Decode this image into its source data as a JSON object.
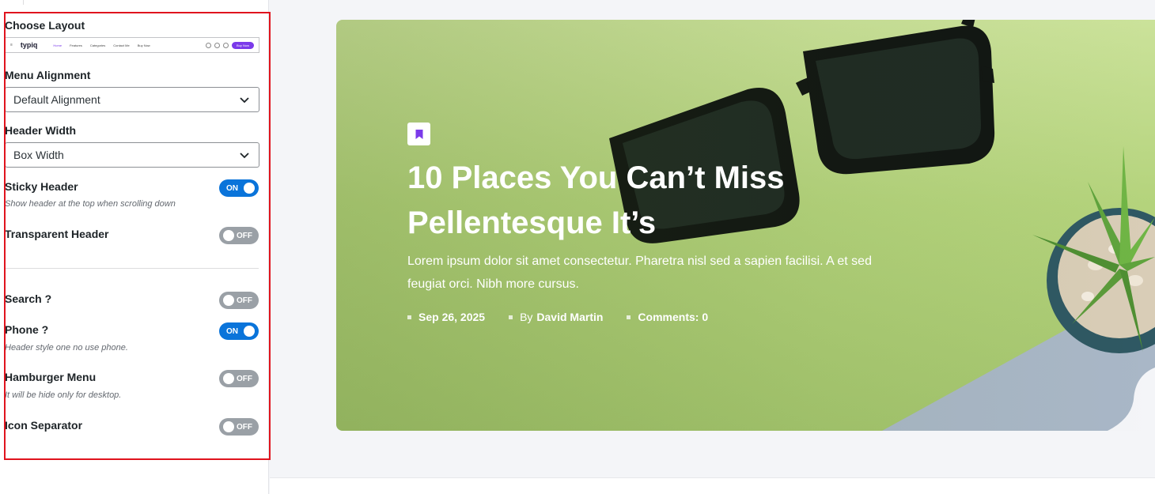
{
  "panel": {
    "choose_layout_label": "Choose Layout",
    "layout_preview": {
      "logo": "typiq",
      "nav": [
        "Home",
        "Features",
        "Categories",
        "Contact Me",
        "Buy Now"
      ],
      "button": "Buy Now"
    },
    "menu_alignment": {
      "label": "Menu Alignment",
      "value": "Default Alignment"
    },
    "header_width": {
      "label": "Header Width",
      "value": "Box Width"
    },
    "sticky_header": {
      "label": "Sticky Header",
      "hint": "Show header at the top when scrolling down",
      "state": "ON"
    },
    "transparent_header": {
      "label": "Transparent Header",
      "state": "OFF"
    },
    "search": {
      "label": "Search ?",
      "state": "OFF"
    },
    "phone": {
      "label": "Phone ?",
      "hint": "Header style one no use phone.",
      "state": "ON"
    },
    "hamburger_menu": {
      "label": "Hamburger Menu",
      "hint": "It will be hide only for desktop.",
      "state": "OFF"
    },
    "icon_separator": {
      "label": "Icon Separator",
      "state": "OFF"
    }
  },
  "hero": {
    "title": "10 Places You Can’t Miss Pellentesque It’s",
    "excerpt": "Lorem ipsum dolor sit amet consectetur. Pharetra nisl sed a sapien facilisi. A et sed feugiat orci. Nibh more cursus.",
    "date": "Sep 26, 2025",
    "by_prefix": "By",
    "author": "David Martin",
    "comments": "Comments: 0",
    "badge_icon": "bookmark-icon"
  },
  "colors": {
    "toggle_on": "#0a74da",
    "toggle_off": "#9aa0a6",
    "highlight": "#e0141e",
    "accent": "#7b3aea"
  }
}
